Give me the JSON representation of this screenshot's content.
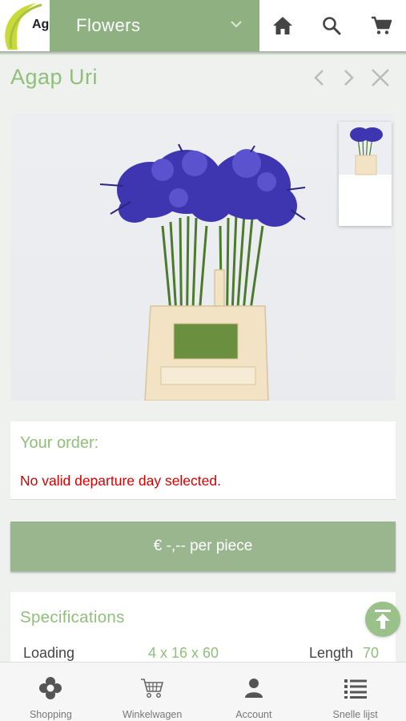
{
  "header": {
    "logo_text": "Ag",
    "category": "Flowers",
    "icons": [
      "home-icon",
      "search-icon",
      "cart-icon"
    ]
  },
  "product": {
    "title": "Agap Uri"
  },
  "order": {
    "title": "Your order:",
    "message": "No valid departure day selected."
  },
  "price": {
    "label": "€ -,-- per piece"
  },
  "specs": {
    "title": "Specifications",
    "loading_label": "Loading",
    "loading_value": "4 x 16 x 60",
    "length_label": "Length",
    "length_value": "70"
  },
  "bottom_nav": {
    "items": [
      {
        "label": "Shopping",
        "icon": "flower-icon"
      },
      {
        "label": "Winkelwagen",
        "icon": "cart-icon"
      },
      {
        "label": "Account",
        "icon": "person-icon"
      },
      {
        "label": "Snelle lijst",
        "icon": "list-icon"
      }
    ]
  },
  "colors": {
    "brand_green": "#8fb182",
    "accent_green": "#8fbf7a",
    "error_red": "#d40000"
  }
}
